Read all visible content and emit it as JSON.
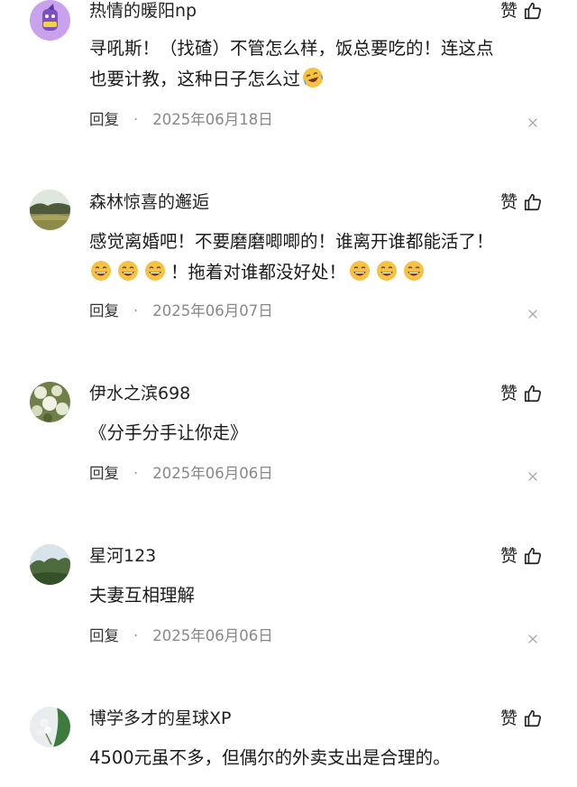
{
  "comments": [
    {
      "username": "热情的暖阳np",
      "like_label": "赞",
      "lines": [
        "寻吼斯！（找碴）不管怎么样，饭总要吃的！连这点",
        "也要计教，这种日子怎么过"
      ],
      "trailing_emoji": "laugh-cry-emoji",
      "reply_label": "回复",
      "separator": "·",
      "date": "2025年06月18日"
    },
    {
      "username": "森林惊喜的邂逅",
      "like_label": "赞",
      "line1": "感觉离婚吧！不要磨磨唧唧的！谁离开谁都能活了！",
      "line2_text": "！拖着对谁都没好处！",
      "emoji_icon": "grin-emoji",
      "reply_label": "回复",
      "separator": "·",
      "date": "2025年06月07日"
    },
    {
      "username": "伊水之滨698",
      "like_label": "赞",
      "text": "《分手分手让你走》",
      "reply_label": "回复",
      "separator": "·",
      "date": "2025年06月06日"
    },
    {
      "username": "星河123",
      "like_label": "赞",
      "text": "夫妻互相理解",
      "reply_label": "回复",
      "separator": "·",
      "date": "2025年06月06日"
    },
    {
      "username": "博学多才的星球XP",
      "like_label": "赞",
      "text": "4500元虽不多，但偶尔的外卖支出是合理的。"
    }
  ],
  "icons": {
    "like": "thumbs-up-icon",
    "close": "close-icon"
  },
  "colors": {
    "text": "#222222",
    "meta": "#888888",
    "emoji_yellow": "#f7c242"
  }
}
